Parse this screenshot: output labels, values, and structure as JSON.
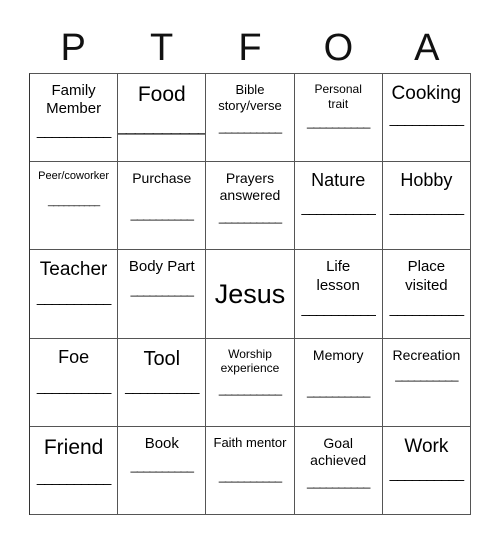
{
  "header": {
    "letters": [
      "P",
      "T",
      "F",
      "O",
      "A"
    ]
  },
  "blank": "__________",
  "cells": [
    [
      "Family Member",
      "Food",
      "Bible story/verse",
      "Personal trait",
      "Cooking"
    ],
    [
      "Peer/coworker",
      "Purchase",
      "Prayers answered",
      "Nature",
      "Hobby"
    ],
    [
      "Teacher",
      "Body Part",
      "Jesus",
      "Life lesson",
      "Place visited"
    ],
    [
      "Foe",
      "Tool",
      "Worship experience",
      "Memory",
      "Recreation"
    ],
    [
      "Friend",
      "Book",
      "Faith mentor",
      "Goal achieved",
      "Work"
    ]
  ],
  "free_space": {
    "row": 2,
    "col": 2,
    "label": "Jesus"
  }
}
